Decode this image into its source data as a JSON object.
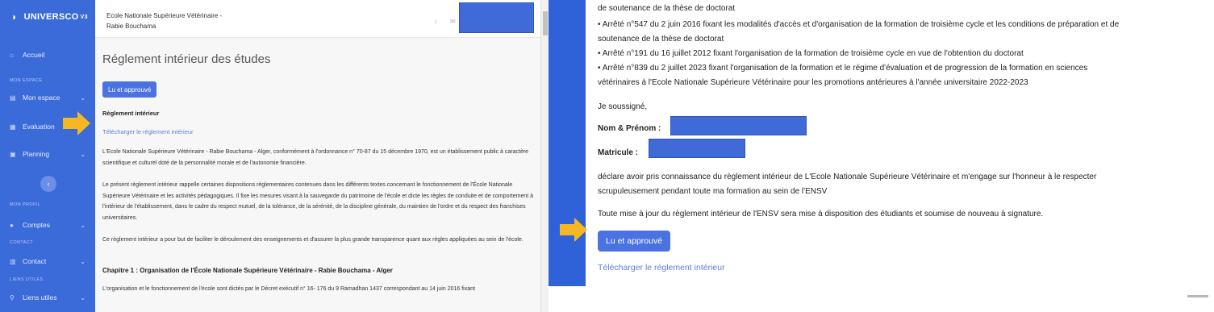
{
  "left": {
    "sidebar": {
      "brand": "UNIVERSCO",
      "brand_sup": "V3",
      "items": {
        "accueil": "Accueil",
        "mon_espace_section": "MON ESPACE",
        "mon_espace": "Mon espace",
        "evaluation": "Evaluation",
        "planning": "Planning",
        "mon_profil_section": "MON PROFIL",
        "comptes": "Comptes",
        "contact_section": "CONTACT",
        "contact": "Contact",
        "liens_section": "LIENS UTILES",
        "liens": "Liens utiles"
      }
    },
    "topbar": {
      "school_line1": "Ecole Nationale Supérieure Vétérinaire -",
      "school_line2": "Rabie Bouchama"
    },
    "content": {
      "title": "Réglement intérieur des études",
      "button": "Lu et approuvé",
      "heading": "Règlement intérieur",
      "download_link": "Télécharger le réglement intérieur",
      "p1": "L'Ecole Nationale Supérieure Vétérinaire - Rabie Bouchama - Alger, conformément à l'ordonnance n° 70-87 du 15 décembre 1970, est un établissement public à caractère scientifique et culturel doté de la personnalité morale et de l'autonomie financière.",
      "p2": "Le présent règlement intérieur rappelle certaines dispositions réglementaires contenues dans les différents textes concernant le fonctionnement de l'École Nationale Supérieure Vétérinaire et les activités pédagogiques. Il fixe les mesures visant à la sauvegarde du patrimoine de l'école et dicte les règles de conduite et de comportement à l'intérieur de l'établissement, dans le cadre du respect mutuel, de la tolérance, de la sérénité, de la discipline générale, du maintien de l'ordre et du respect des franchises universitaires.",
      "p3": "Ce règlement intérieur a pour but de faciliter le déroulement des enseignements et d'assurer la plus grande transparence quant aux règles appliquées au sein de l'école.",
      "chapter": "Chapitre 1 : Organisation de l'École Nationale Supérieure Vétérinaire - Rabie Bouchama - Alger",
      "p4": "L'organisation et le fonctionnement de l'école sont dictés par le Décret exécutif n° 16- 176 du 9 Ramadhan 1437 correspondant au 14 juin 2016 fixant"
    }
  },
  "right": {
    "line0": "de soutenance de la thèse de doctorat",
    "line1": "• Arrêté n°547 du 2 juin 2016 fixant les modalités d'accès et d'organisation de la formation de troisième cycle et les conditions de préparation et de",
    "line2": "soutenance de la thèse de doctorat",
    "line3": "• Arrêté n°191 du 16 juillet 2012 fixant l'organisation de la formation de troisième cycle en vue de l'obtention du doctorat",
    "line4": "• Arrêté n°839 du 2 juillet 2023 fixant l'organisation de la formation et le régime d'évaluation et de progression de la formation en sciences",
    "line5": "vétérinaires à l'Ecole Nationale Supérieure Vétérinaire pour les promotions antérieures à l'année universitaire 2022-2023",
    "je_soussigne": "Je soussigné,",
    "nom_label": "Nom & Prénom :",
    "matricule_label": "Matricule :",
    "declare1": "déclare avoir pris connaissance du règlement intérieur de L'Ecole Nationale Supérieure Vétérinaire et m'engage sur l'honneur à le respecter",
    "declare2": "scrupuleusement pendant toute ma formation au sein de l'ENSV",
    "mise_a_jour": "Toute mise à jour du règlement intérieur de l'ENSV sera mise à disposition des étudiants et soumise de nouveau à signature.",
    "button": "Lu et approuvé",
    "download_link": "Télécharger le réglement intérieur"
  },
  "colors": {
    "sidebar": "#3b6ad9",
    "button": "#4a72e0",
    "link": "#5b7fd6",
    "arrow": "#f5b820",
    "redaction": "#3f6ad8"
  },
  "icons": [
    "home-icon",
    "folder-icon",
    "evaluation-icon",
    "calendar-icon",
    "user-icon",
    "contact-icon",
    "link-icon",
    "bell-icon",
    "mail-icon",
    "chevron-left-icon",
    "chevron-down-icon"
  ]
}
